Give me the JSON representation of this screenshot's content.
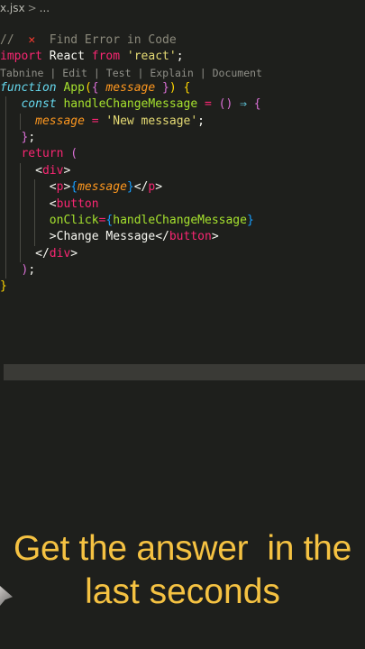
{
  "breadcrumb": {
    "file": "x.jsx",
    "sep": ">",
    "rest": "..."
  },
  "codelens": {
    "items": [
      "Tabnine",
      "Edit",
      "Test",
      "Explain",
      "Document"
    ],
    "sep": "|"
  },
  "code": {
    "l1_comment_slashes": "//",
    "l1_x": "✕",
    "l1_comment_text": "Find Error in Code",
    "l2_import": "import",
    "l2_name": "React",
    "l2_from": "from",
    "l2_str": "'react'",
    "l2_semi": ";",
    "l3_function": "function",
    "l3_name": "App",
    "l3_open": "(",
    "l3_brace_open": "{",
    "l3_param": "message",
    "l3_brace_close": "}",
    "l3_close": ")",
    "l3_body": "{",
    "l4_const": "const",
    "l4_name": "handleChangeMessage",
    "l4_eq": "=",
    "l4_parens": "()",
    "l4_arrow": "⇒",
    "l4_body": "{",
    "l5_var": "message",
    "l5_eq": "=",
    "l5_str": "'New message'",
    "l5_semi": ";",
    "l6_close": "}",
    "l6_semi": ";",
    "l7_return": "return",
    "l7_paren": "(",
    "l8_lt": "<",
    "l8_tag": "div",
    "l8_gt": ">",
    "l9_lt": "<",
    "l9_tag": "p",
    "l9_gt": ">",
    "l9_bo": "{",
    "l9_var": "message",
    "l9_bc": "}",
    "l9_lt2": "</",
    "l9_tag2": "p",
    "l9_gt2": ">",
    "l10_lt": "<",
    "l10_tag": "button",
    "l11_attr": "onClick",
    "l11_eq": "=",
    "l11_bo": "{",
    "l11_fn": "handleChangeMessage",
    "l11_bc": "}",
    "l12_text": ">Change Message",
    "l12_lt": "</",
    "l12_tag": "button",
    "l12_gt": ">",
    "l13_lt": "</",
    "l13_tag": "div",
    "l13_gt": ">",
    "l14_paren": ")",
    "l14_semi": ";",
    "l15_brace": "}"
  },
  "caption": {
    "line1": "Get the answer  in the",
    "line2": "last seconds"
  },
  "colors": {
    "background": "#1e1f1c",
    "caption": "#f5c242",
    "error_x": "#ff3b30"
  }
}
